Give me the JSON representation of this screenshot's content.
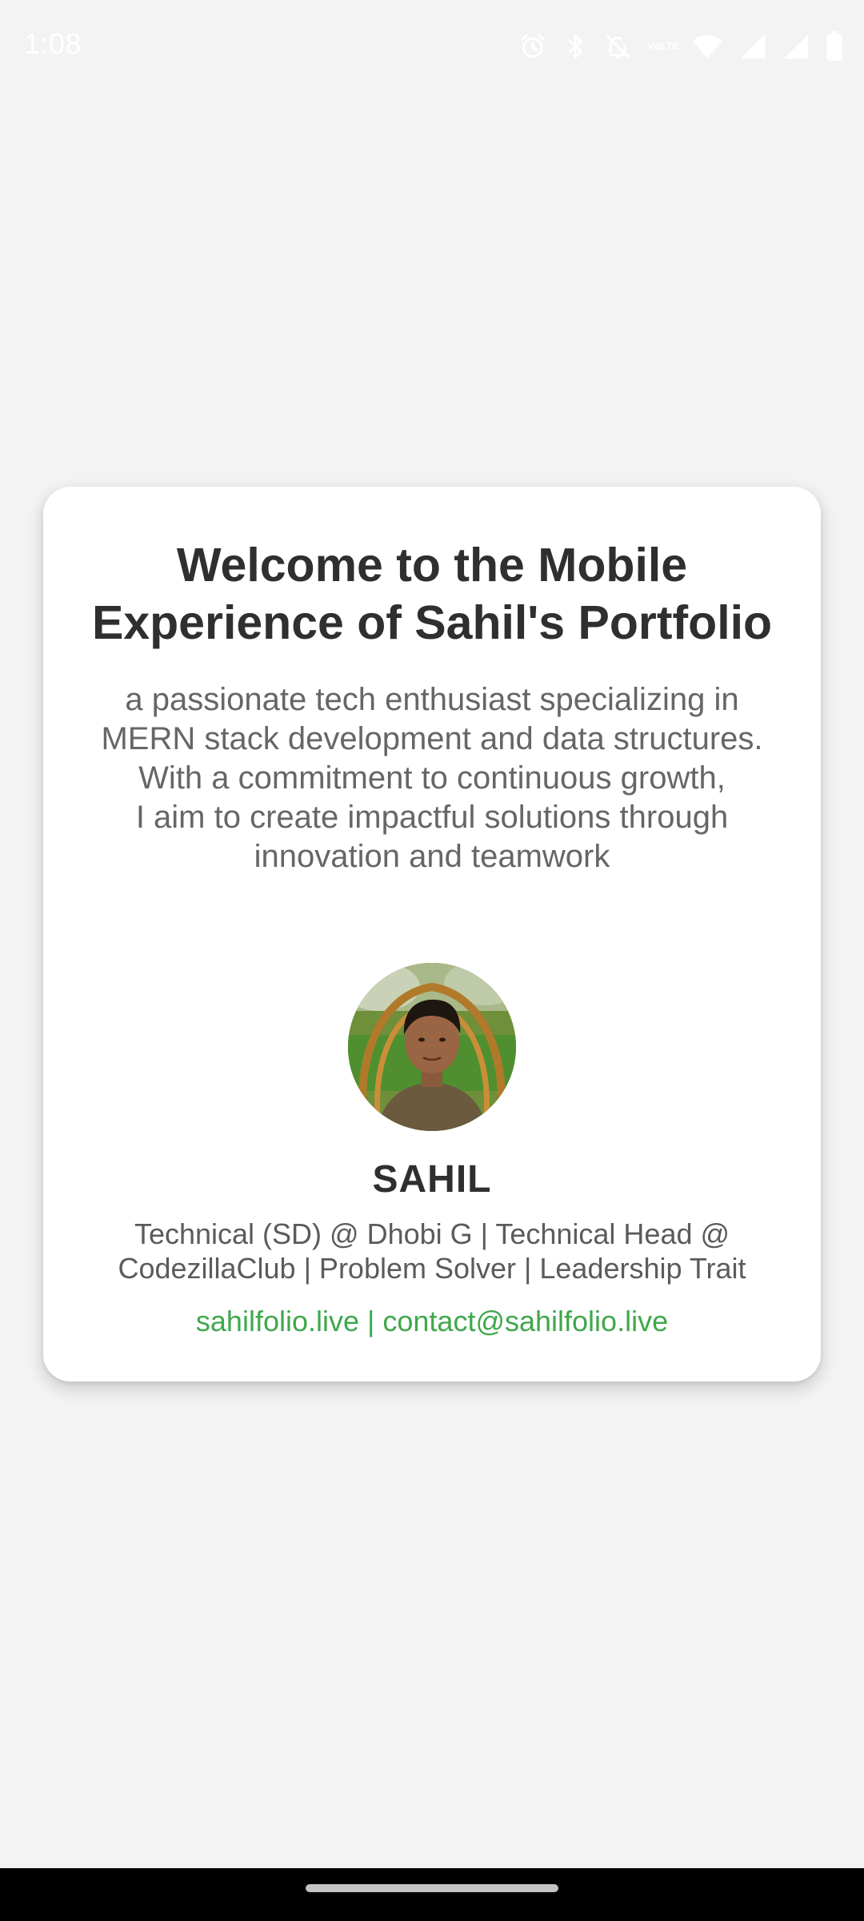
{
  "status_bar": {
    "time": "1:08",
    "network_label": "VoLTE",
    "icons": [
      "alarm-icon",
      "bluetooth-icon",
      "mute-icon",
      "volte-icon",
      "wifi-icon",
      "signal-icon",
      "signal-roaming-icon",
      "battery-icon"
    ]
  },
  "card": {
    "title_lines": [
      "Welcome to the Mobile",
      "Experience of Sahil's Portfolio"
    ],
    "description_lines": [
      "a passionate tech enthusiast specializing in",
      "MERN stack development and data structures.",
      "With a commitment to continuous growth,",
      "I aim to create impactful solutions through",
      "innovation and teamwork"
    ],
    "avatar_alt": "Profile photo",
    "name": "SAHIL",
    "role_lines": [
      "Technical (SD) @ Dhobi G | Technical Head @",
      "CodezillaClub | Problem Solver | Leadership Trait"
    ],
    "links": {
      "website": "sahilfolio.live",
      "separator": " | ",
      "email": "contact@sahilfolio.live"
    }
  },
  "colors": {
    "background": "#f3f3f3",
    "card": "#ffffff",
    "title": "#2f2f2f",
    "body_text": "#666666",
    "link": "#3fa84b",
    "nav_bar": "#000000"
  }
}
